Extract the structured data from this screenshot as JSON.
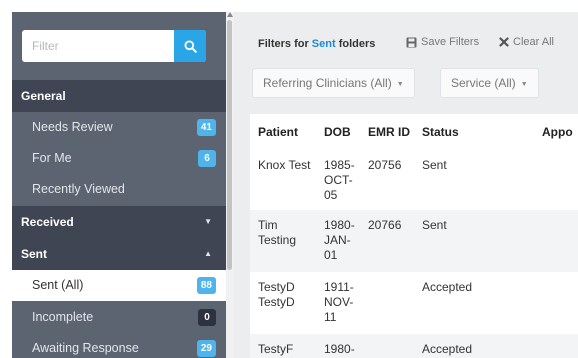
{
  "sidebar": {
    "filter": {
      "placeholder": "Filter",
      "value": "",
      "button_icon": "search-icon"
    },
    "sections": {
      "general": {
        "label": "General"
      },
      "received": {
        "label": "Received"
      },
      "sent": {
        "label": "Sent"
      }
    },
    "general_items": [
      {
        "label": "Needs Review",
        "badge": "41"
      },
      {
        "label": "For Me",
        "badge": "6"
      },
      {
        "label": "Recently Viewed"
      }
    ],
    "sent_items": [
      {
        "label": "Sent (All)",
        "badge": "88",
        "active": true
      },
      {
        "label": "Incomplete",
        "badge": "0"
      },
      {
        "label": "Awaiting Response",
        "badge": "29"
      }
    ]
  },
  "main": {
    "filters_prefix": "Filters for ",
    "filters_highlight": "Sent",
    "filters_suffix": " folders",
    "save_filters": "Save Filters",
    "clear_all": "Clear All",
    "dropdowns": {
      "referring": "Referring Clinicians (All)",
      "service": "Service (All)"
    },
    "table": {
      "columns": [
        "Patient",
        "DOB",
        "EMR ID",
        "Status",
        "Appo"
      ],
      "rows": [
        {
          "patient": [
            "Knox Test"
          ],
          "dob": [
            "1985-",
            "OCT-",
            "05"
          ],
          "emr": "20756",
          "status": "Sent"
        },
        {
          "patient": [
            "Tim",
            "Testing"
          ],
          "dob": [
            "1980-",
            "JAN-",
            "01"
          ],
          "emr": "20766",
          "status": "Sent"
        },
        {
          "patient": [
            "TestyD",
            "TestyD"
          ],
          "dob": [
            "1911-",
            "NOV-",
            "11"
          ],
          "emr": "",
          "status": "Accepted"
        },
        {
          "patient": [
            "TestyF"
          ],
          "dob": [
            "1980-"
          ],
          "emr": "",
          "status": "Accepted"
        }
      ]
    }
  },
  "colors": {
    "sidebar": "#5d6471",
    "section": "#3f4552",
    "accent": "#2aa6e6",
    "badge": "#4fb3ec",
    "link": "#1f8ad3"
  }
}
